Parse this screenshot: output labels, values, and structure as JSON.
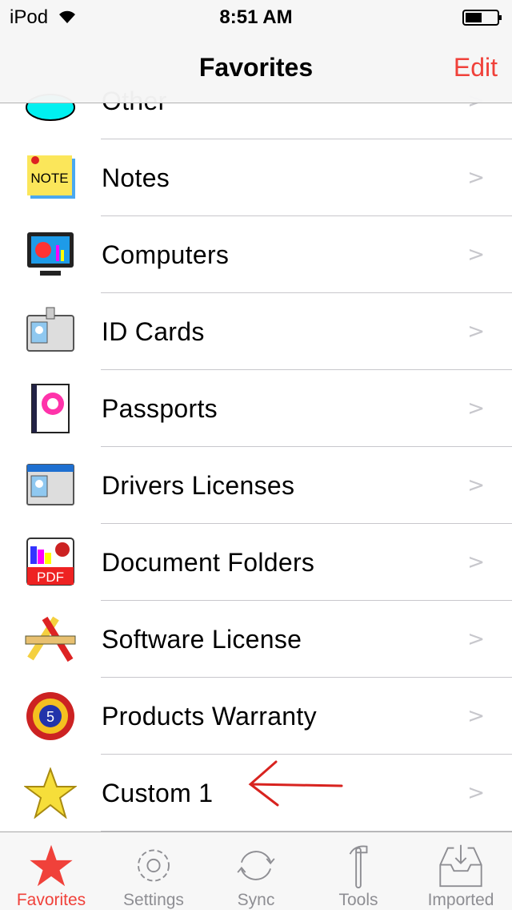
{
  "status_bar": {
    "carrier": "iPod",
    "time": "8:51 AM",
    "battery_level": 0.5
  },
  "nav": {
    "title": "Favorites",
    "edit_label": "Edit"
  },
  "accent_color": "#f0413a",
  "items": [
    {
      "label": "Other",
      "icon": "cloud-icon"
    },
    {
      "label": "Notes",
      "icon": "note-icon"
    },
    {
      "label": "Computers",
      "icon": "computer-icon"
    },
    {
      "label": "ID Cards",
      "icon": "id-card-icon"
    },
    {
      "label": "Passports",
      "icon": "passport-icon"
    },
    {
      "label": "Drivers Licenses",
      "icon": "drivers-license-icon"
    },
    {
      "label": "Document Folders",
      "icon": "pdf-icon"
    },
    {
      "label": "Software License",
      "icon": "pencil-ruler-icon"
    },
    {
      "label": "Products Warranty",
      "icon": "warranty-badge-icon"
    },
    {
      "label": "Custom 1",
      "icon": "star-icon"
    }
  ],
  "chevron": ">",
  "tabs": [
    {
      "label": "Favorites",
      "icon": "star-icon",
      "active": true
    },
    {
      "label": "Settings",
      "icon": "gear-icon"
    },
    {
      "label": "Sync",
      "icon": "sync-icon"
    },
    {
      "label": "Tools",
      "icon": "hammer-icon"
    },
    {
      "label": "Imported",
      "icon": "inbox-icon"
    }
  ]
}
